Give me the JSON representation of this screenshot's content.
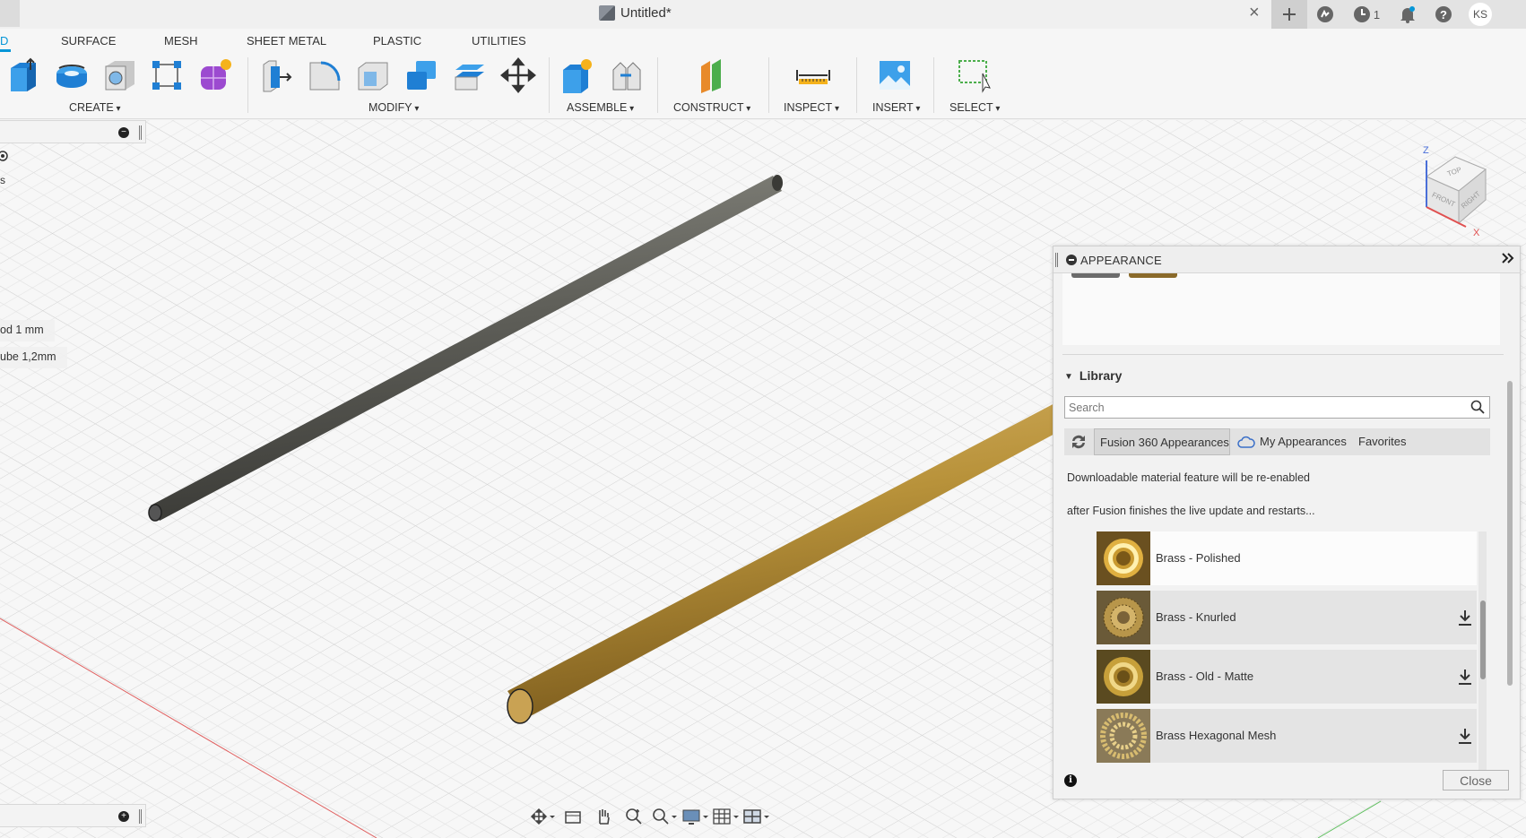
{
  "window": {
    "title": "Untitled*",
    "close_symbol": "×",
    "notification_count": "1",
    "user_initials": "KS"
  },
  "tabs": [
    {
      "label": "D",
      "active": true
    },
    {
      "label": "SURFACE"
    },
    {
      "label": "MESH"
    },
    {
      "label": "SHEET METAL"
    },
    {
      "label": "PLASTIC"
    },
    {
      "label": "UTILITIES"
    }
  ],
  "toolbar": {
    "groups": [
      {
        "label": "CREATE",
        "icons": [
          "extrude-icon",
          "revolve-icon",
          "hole-icon",
          "pattern-icon",
          "form-icon"
        ]
      },
      {
        "label": "MODIFY",
        "icons": [
          "press-pull-icon",
          "fillet-icon",
          "shell-icon",
          "combine-icon",
          "offset-face-icon",
          "move-icon"
        ]
      },
      {
        "label": "ASSEMBLE",
        "icons": [
          "new-component-icon",
          "joint-icon"
        ]
      },
      {
        "label": "CONSTRUCT",
        "icons": [
          "offset-plane-icon"
        ]
      },
      {
        "label": "INSPECT",
        "icons": [
          "measure-icon"
        ]
      },
      {
        "label": "INSERT",
        "icons": [
          "insert-image-icon"
        ]
      },
      {
        "label": "SELECT",
        "icons": [
          "select-window-icon"
        ]
      }
    ]
  },
  "browser": {
    "labels": [
      "od 1 mm",
      "ube 1,2mm"
    ],
    "partial_label": "s",
    "circle_minus": "−",
    "circle_plus": "+"
  },
  "viewcube": {
    "faces": [
      "TOP",
      "FRONT",
      "RIGHT"
    ],
    "axes": [
      "Z",
      "X"
    ]
  },
  "appearance": {
    "title": "APPEARANCE",
    "library_heading": "Library",
    "search_placeholder": "Search",
    "library_tabs": [
      "Fusion 360 Appearances",
      "My Appearances",
      "Favorites"
    ],
    "notice_line1": "Downloadable material feature will be re-enabled",
    "notice_line2": "after Fusion finishes the live update and restarts...",
    "materials": [
      {
        "name": "Brass - Polished",
        "downloadable": false
      },
      {
        "name": "Brass - Knurled",
        "downloadable": true
      },
      {
        "name": "Brass - Old - Matte",
        "downloadable": true
      },
      {
        "name": "Brass Hexagonal Mesh",
        "downloadable": true
      }
    ],
    "close_label": "Close",
    "info_symbol": "i"
  },
  "colors": {
    "accent": "#0696d7",
    "brass": "#b8923a",
    "steel_rod": "#5e5e58",
    "x_axis": "#e06060",
    "y_axis": "#60c060"
  }
}
